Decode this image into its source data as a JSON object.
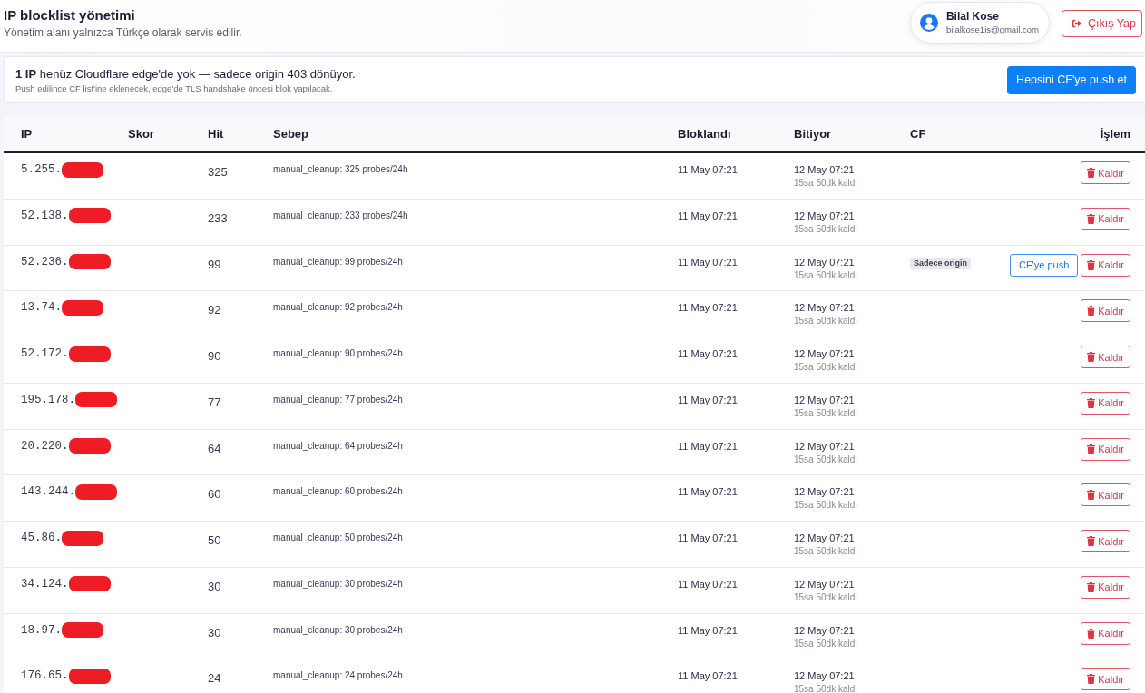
{
  "header": {
    "title": "IP blocklist yönetimi",
    "subtitle": "Yönetim alanı yalnızca Türkçe olarak servis edilir."
  },
  "user": {
    "name": "Bilal Kose",
    "email": "bilalkose1is@gmail.com"
  },
  "logout_button": {
    "label": "Çıkış Yap"
  },
  "notice": {
    "message": "**1 IP** henüz Cloudflare edge'de yok — sadece origin 403 dönüyor.",
    "detail": "Push edilince CF list'ine eklenecek, edge'de TLS handshake öncesi blok yapılacak.",
    "button": "Hepsini CF'ye push et"
  },
  "table": {
    "columns": [
      "IP",
      "Skor",
      "Hit",
      "Sebep",
      "Bloklandı",
      "Bitiyor",
      "CF",
      "İşlem"
    ],
    "rows": [
      {
        "ip": "5.255.",
        "redacted": true,
        "hit": "325",
        "reason": "manual_cleanup: 325 probes/24h",
        "blocked": "11 May 07:21",
        "expires": "12 May 07:21",
        "remaining": "15sa 50dk kaldı",
        "actions": [
          {
            "kind": "remove",
            "label": "Kaldır"
          }
        ]
      },
      {
        "ip": "52.138.",
        "redacted": true,
        "hit": "233",
        "reason": "manual_cleanup: 233 probes/24h",
        "blocked": "11 May 07:21",
        "expires": "12 May 07:21",
        "remaining": "15sa 50dk kaldı",
        "actions": [
          {
            "kind": "remove",
            "label": "Kaldır"
          }
        ]
      },
      {
        "ip": "52.236.",
        "redacted": true,
        "hit": "99",
        "reason": "manual_cleanup: 99 probes/24h",
        "blocked": "11 May 07:21",
        "expires": "12 May 07:21",
        "remaining": "15sa 50dk kaldı",
        "cf_badge": "Sadece origin",
        "actions": [
          {
            "kind": "push",
            "label": "CF'ye push"
          },
          {
            "kind": "remove",
            "label": "Kaldır"
          }
        ]
      },
      {
        "ip": "13.74.",
        "redacted": true,
        "hit": "92",
        "reason": "manual_cleanup: 92 probes/24h",
        "blocked": "11 May 07:21",
        "expires": "12 May 07:21",
        "remaining": "15sa 50dk kaldı",
        "actions": [
          {
            "kind": "remove",
            "label": "Kaldır"
          }
        ]
      },
      {
        "ip": "52.172.",
        "redacted": true,
        "hit": "90",
        "reason": "manual_cleanup: 90 probes/24h",
        "blocked": "11 May 07:21",
        "expires": "12 May 07:21",
        "remaining": "15sa 50dk kaldı",
        "actions": [
          {
            "kind": "remove",
            "label": "Kaldır"
          }
        ]
      },
      {
        "ip": "195.178.",
        "redacted": true,
        "hit": "77",
        "reason": "manual_cleanup: 77 probes/24h",
        "blocked": "11 May 07:21",
        "expires": "12 May 07:21",
        "remaining": "15sa 50dk kaldı",
        "actions": [
          {
            "kind": "remove",
            "label": "Kaldır"
          }
        ]
      },
      {
        "ip": "20.220.",
        "redacted": true,
        "hit": "64",
        "reason": "manual_cleanup: 64 probes/24h",
        "blocked": "11 May 07:21",
        "expires": "12 May 07:21",
        "remaining": "15sa 50dk kaldı",
        "actions": [
          {
            "kind": "remove",
            "label": "Kaldır"
          }
        ]
      },
      {
        "ip": "143.244.",
        "redacted": true,
        "hit": "60",
        "reason": "manual_cleanup: 60 probes/24h",
        "blocked": "11 May 07:21",
        "expires": "12 May 07:21",
        "remaining": "15sa 50dk kaldı",
        "actions": [
          {
            "kind": "remove",
            "label": "Kaldır"
          }
        ]
      },
      {
        "ip": "45.86.",
        "redacted": true,
        "hit": "50",
        "reason": "manual_cleanup: 50 probes/24h",
        "blocked": "11 May 07:21",
        "expires": "12 May 07:21",
        "remaining": "15sa 50dk kaldı",
        "actions": [
          {
            "kind": "remove",
            "label": "Kaldır"
          }
        ]
      },
      {
        "ip": "34.124.",
        "redacted": true,
        "hit": "30",
        "reason": "manual_cleanup: 30 probes/24h",
        "blocked": "11 May 07:21",
        "expires": "12 May 07:21",
        "remaining": "15sa 50dk kaldı",
        "actions": [
          {
            "kind": "remove",
            "label": "Kaldır"
          }
        ]
      },
      {
        "ip": "18.97.",
        "redacted": true,
        "hit": "30",
        "reason": "manual_cleanup: 30 probes/24h",
        "blocked": "11 May 07:21",
        "expires": "12 May 07:21",
        "remaining": "15sa 50dk kaldı",
        "actions": [
          {
            "kind": "remove",
            "label": "Kaldır"
          }
        ]
      },
      {
        "ip": "176.65.",
        "redacted": true,
        "hit": "24",
        "reason": "manual_cleanup: 24 probes/24h",
        "blocked": "11 May 07:21",
        "expires": "12 May 07:21",
        "remaining": "15sa 50dk kaldı",
        "actions": [
          {
            "kind": "remove",
            "label": "Kaldır"
          }
        ]
      }
    ]
  }
}
